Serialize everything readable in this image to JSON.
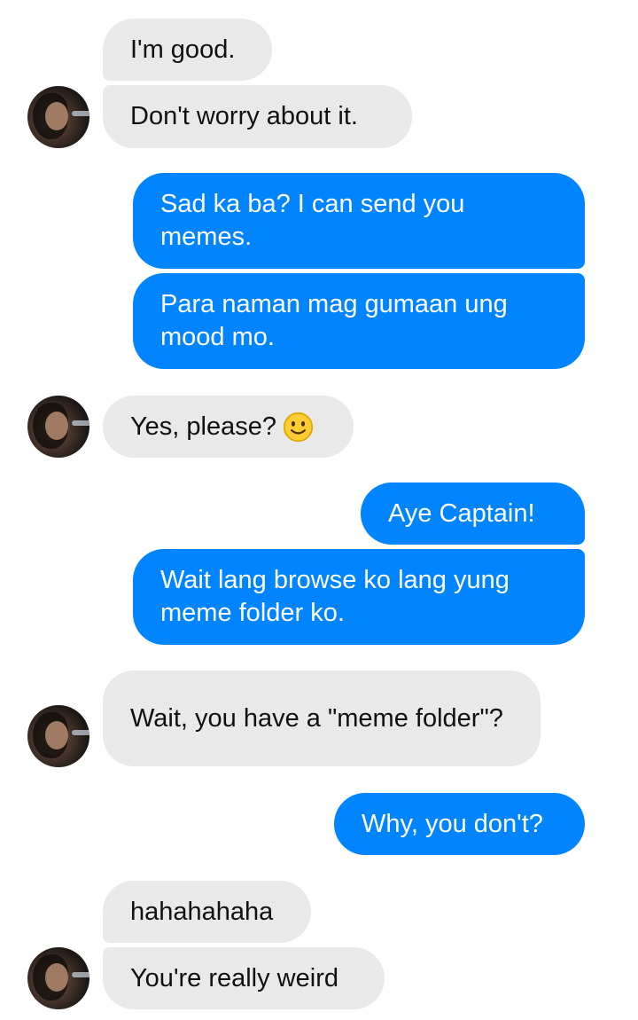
{
  "messages": [
    {
      "side": "in",
      "text": "I'm good."
    },
    {
      "side": "in",
      "text": "Don't worry about it."
    },
    {
      "side": "out",
      "text": "Sad ka ba? I can send you memes."
    },
    {
      "side": "out",
      "text": "Para naman mag gumaan ung mood mo."
    },
    {
      "side": "in",
      "text": "Yes, please?",
      "emoji": "slightly-smiling-face-icon"
    },
    {
      "side": "out",
      "text": "Aye Captain!"
    },
    {
      "side": "out",
      "text": "Wait lang browse ko lang yung meme folder ko."
    },
    {
      "side": "in",
      "text": "Wait, you have a \"meme folder\"?"
    },
    {
      "side": "out",
      "text": "Why, you don't?"
    },
    {
      "side": "in",
      "text": "hahahahaha"
    },
    {
      "side": "in",
      "text": "You're really weird"
    }
  ],
  "colors": {
    "incoming_bubble": "#e9e9e9",
    "outgoing_bubble": "#0084ff",
    "outgoing_text": "#ffffff",
    "incoming_text": "#111111"
  }
}
